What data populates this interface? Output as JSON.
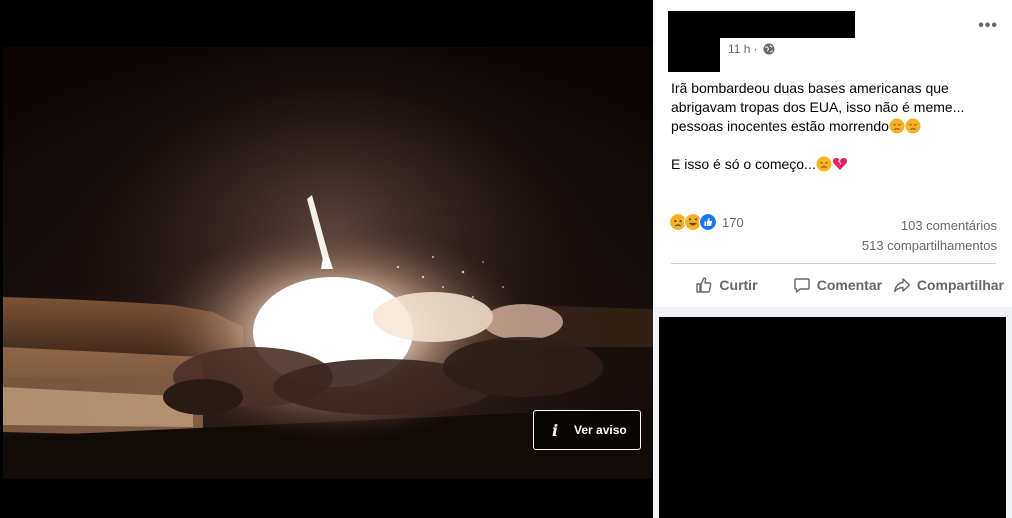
{
  "media": {
    "warning_button_label": "Ver aviso",
    "warning_icon_glyph": "i"
  },
  "post": {
    "time": "11 h",
    "separator": "·",
    "more_label": "•••",
    "text_line_1": "Irã bombardeou duas bases americanas que abrigavam tropas dos EUA, isso não é meme... pessoas inocentes estão morrendo",
    "text_line_2": "E isso é só o começo...",
    "reaction_count": "170",
    "comments": "103 comentários",
    "shares": "513 compartilhamentos",
    "actions": {
      "like": "Curtir",
      "comment": "Comentar",
      "share": "Compartilhar"
    }
  },
  "colors": {
    "secondary_text": "#65676b",
    "primary_text": "#050505",
    "like_blue": "#1877f2",
    "emoji_yellow": "#f7b125"
  },
  "icons": [
    "info-icon",
    "globe-icon",
    "more-icon",
    "sad-emoji-icon",
    "broken-heart-icon",
    "like-reaction-icon",
    "laugh-reaction-icon",
    "sad-reaction-icon",
    "thumb-up-icon",
    "comment-icon",
    "share-arrow-icon"
  ]
}
